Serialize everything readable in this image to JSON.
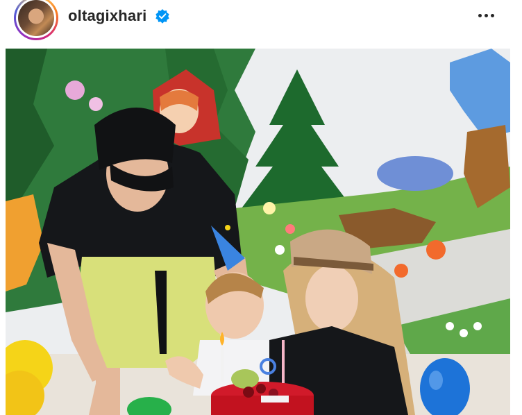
{
  "header": {
    "username": "oltagixhari",
    "verified": true,
    "avatar_icon": "profile-photo",
    "more_icon": "more-horizontal-icon"
  },
  "post": {
    "media_type": "photo",
    "scene": [
      "birthday-cake",
      "candles",
      "party-hat",
      "balloons",
      "painted-forest-mural"
    ]
  },
  "colors": {
    "text": "#262626",
    "verified_badge": "#0095f6",
    "story_ring": [
      "#feda75",
      "#fa7e1e",
      "#d62976",
      "#962fbf",
      "#4f5bd5"
    ]
  }
}
